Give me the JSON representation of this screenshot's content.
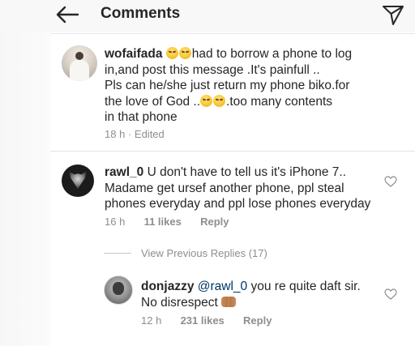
{
  "header": {
    "title": "Comments",
    "back_icon": "arrow-left-icon",
    "send_icon": "paper-plane-icon"
  },
  "caption": {
    "username": "wofaifada",
    "line1_after_emoji": "had to borrow a phone to log",
    "line2": "in,and post this message .It's painfull ..",
    "line3": "Pls can he/she just return my phone biko.for",
    "line4_before_emoji": "the love of God ..",
    "line4_after_emoji": ".too many contents",
    "line5": "in that phone",
    "time": "18 h",
    "edited": "Edited",
    "separator": "·"
  },
  "comment1": {
    "username": "rawl_0",
    "line1_text": "U don't have to tell us it's iPhone 7..",
    "line2": "Madame get ursef another phone, ppl steal",
    "line3": "phones everyday and ppl lose phones everyday",
    "time": "16 h",
    "likes": "11 likes",
    "reply": "Reply"
  },
  "view_previous": "View Previous Replies (17)",
  "reply1": {
    "username": "donjazzy",
    "mention": "@rawl_0",
    "line1_rest": "you re quite daft sir.",
    "line2": "No disrespect",
    "time": "12 h",
    "likes": "231 likes",
    "reply": "Reply"
  },
  "colors": {
    "text": "#262626",
    "muted": "#8e8e8e",
    "mention": "#003569",
    "divider": "#e3e3e3"
  }
}
